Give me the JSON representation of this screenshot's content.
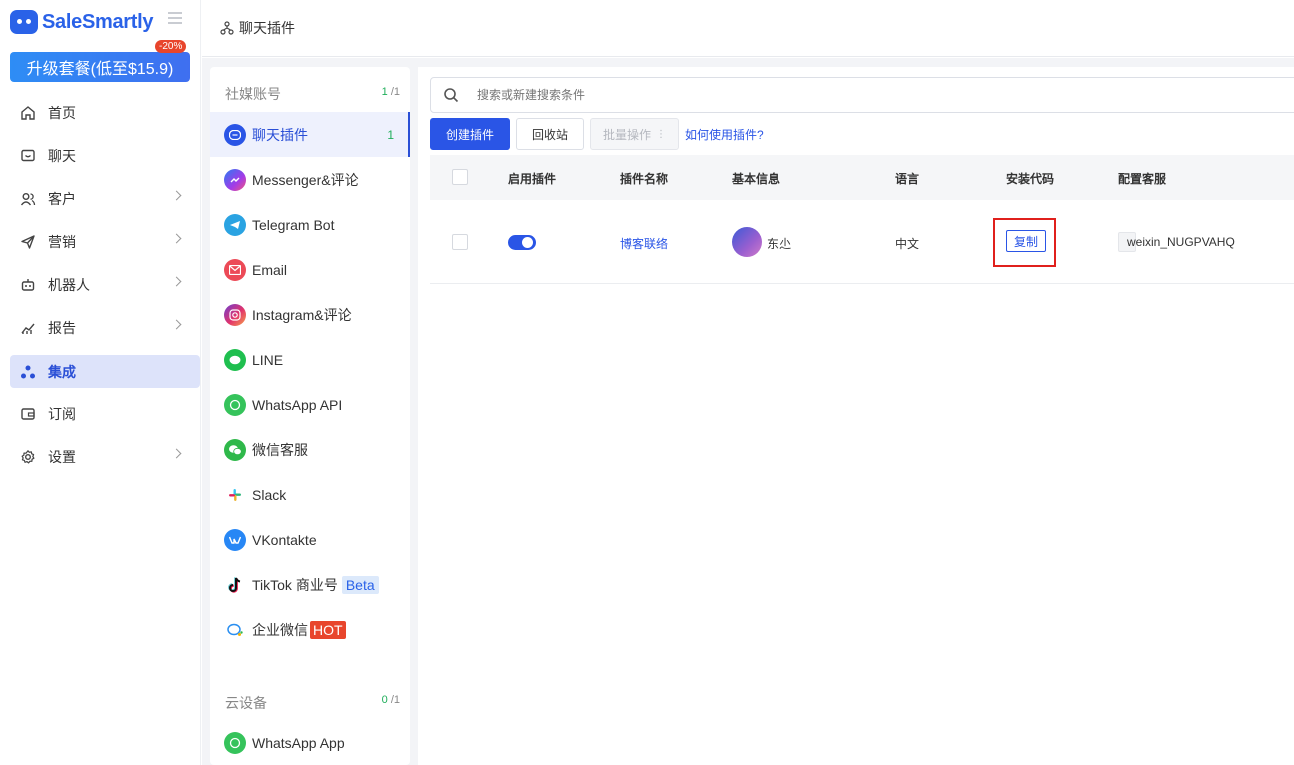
{
  "brand": {
    "name": "SaleSmartly"
  },
  "upgrade": {
    "label": "升级套餐(低至$15.9)",
    "badge": "-20%"
  },
  "nav": {
    "items": [
      {
        "label": "首页",
        "icon": "home-icon"
      },
      {
        "label": "聊天",
        "icon": "chat-icon"
      },
      {
        "label": "客户",
        "icon": "users-icon"
      },
      {
        "label": "营销",
        "icon": "send-icon"
      },
      {
        "label": "机器人",
        "icon": "robot-icon"
      },
      {
        "label": "报告",
        "icon": "chart-icon"
      },
      {
        "label": "集成",
        "icon": "integration-icon"
      },
      {
        "label": "订阅",
        "icon": "wallet-icon"
      },
      {
        "label": "设置",
        "icon": "gear-icon"
      }
    ]
  },
  "header": {
    "title": "聊天插件"
  },
  "channels": {
    "social": {
      "title": "社媒账号",
      "count_used": "1",
      "count_total": " /1"
    },
    "items": [
      {
        "label": "聊天插件",
        "count": "1"
      },
      {
        "label": "Messenger&评论"
      },
      {
        "label": "Telegram Bot"
      },
      {
        "label": "Email"
      },
      {
        "label": "Instagram&评论"
      },
      {
        "label": "LINE"
      },
      {
        "label": "WhatsApp API"
      },
      {
        "label": "微信客服"
      },
      {
        "label": "Slack"
      },
      {
        "label": "VKontakte"
      },
      {
        "label": "TikTok 商业号",
        "tag": "Beta"
      },
      {
        "label": "企业微信",
        "tag": "HOT"
      }
    ],
    "cloud": {
      "title": "云设备",
      "count_used": "0",
      "count_total": " /1"
    },
    "cloud_items": [
      {
        "label": "WhatsApp App"
      }
    ]
  },
  "toolbar": {
    "search_placeholder": "搜索或新建搜索条件",
    "create": "创建插件",
    "recycle": "回收站",
    "batch": "批量操作",
    "help": "如何使用插件?"
  },
  "table": {
    "columns": [
      "启用插件",
      "插件名称",
      "基本信息",
      "语言",
      "安装代码",
      "配置客服"
    ],
    "rows": [
      {
        "enabled": true,
        "name": "博客联络",
        "info": "东尐",
        "language": "中文",
        "code_button": "复制",
        "agent": "weixin_NUGPVAHQ"
      }
    ]
  },
  "colors": {
    "primary": "#2a55e6",
    "active_bg": "#dde3fa",
    "highlight": "#e0201c"
  }
}
